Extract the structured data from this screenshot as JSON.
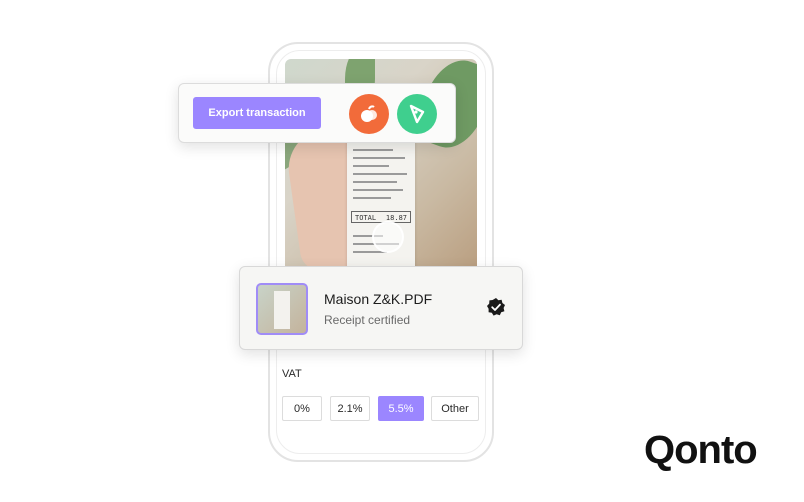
{
  "export_card": {
    "button_label": "Export transaction",
    "integrations": [
      {
        "icon": "orange-fruit-icon",
        "color": "#f26b3a"
      },
      {
        "icon": "green-leaf-tag-icon",
        "color": "#3fcf8e"
      }
    ]
  },
  "receipt_preview": {
    "total_label": "TOTAL",
    "total_value": "18.87"
  },
  "file_card": {
    "file_name": "Maison Z&K.PDF",
    "status": "Receipt certified",
    "status_icon": "verified-check-icon"
  },
  "vat": {
    "label": "VAT",
    "options": [
      "0%",
      "2.1%",
      "5.5%",
      "Other"
    ],
    "selected": "5.5%"
  },
  "brand": {
    "name": "Qonto"
  },
  "colors": {
    "accent": "#9b86ff",
    "orange": "#f26b3a",
    "green": "#3fcf8e"
  }
}
